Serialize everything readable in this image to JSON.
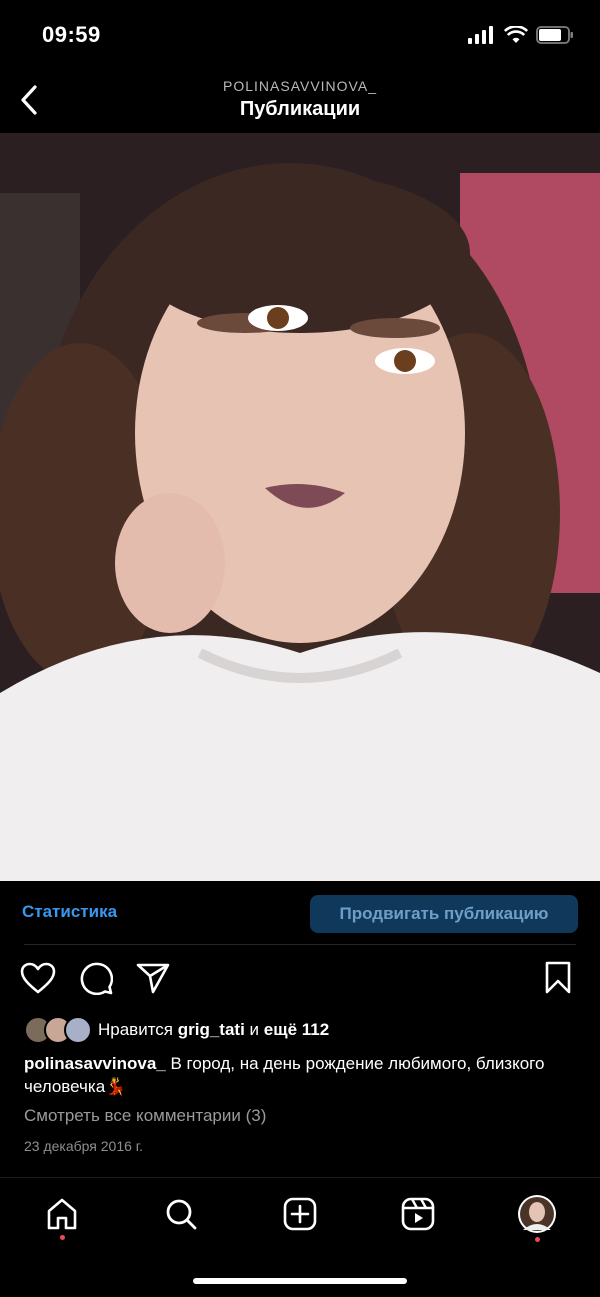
{
  "status": {
    "time": "09:59"
  },
  "header": {
    "username": "POLINASAVVINOVA_",
    "title": "Публикации"
  },
  "post": {
    "stats_label": "Статистика",
    "promote_label": "Продвигать публикацию",
    "likes": {
      "prefix": "Нравится",
      "user": "grig_tati",
      "conj": "и",
      "more": "ещё 112"
    },
    "caption_user": "polinasavvinova_",
    "caption_text": "В город, на день рождение любимого, близкого человечка💃",
    "view_comments": "Смотреть все комментарии (3)",
    "date": "23 декабря 2016 г."
  },
  "icons": {
    "header": [
      "back-icon"
    ],
    "actions": [
      "heart-icon",
      "comment-icon",
      "share-icon",
      "bookmark-icon"
    ],
    "tabbar": [
      "home-icon",
      "search-icon",
      "add-icon",
      "reels-icon",
      "profile-avatar"
    ]
  },
  "colors": {
    "link": "#3897f0",
    "promote_bg": "#10385a",
    "notification_dot": "#ed4956"
  }
}
